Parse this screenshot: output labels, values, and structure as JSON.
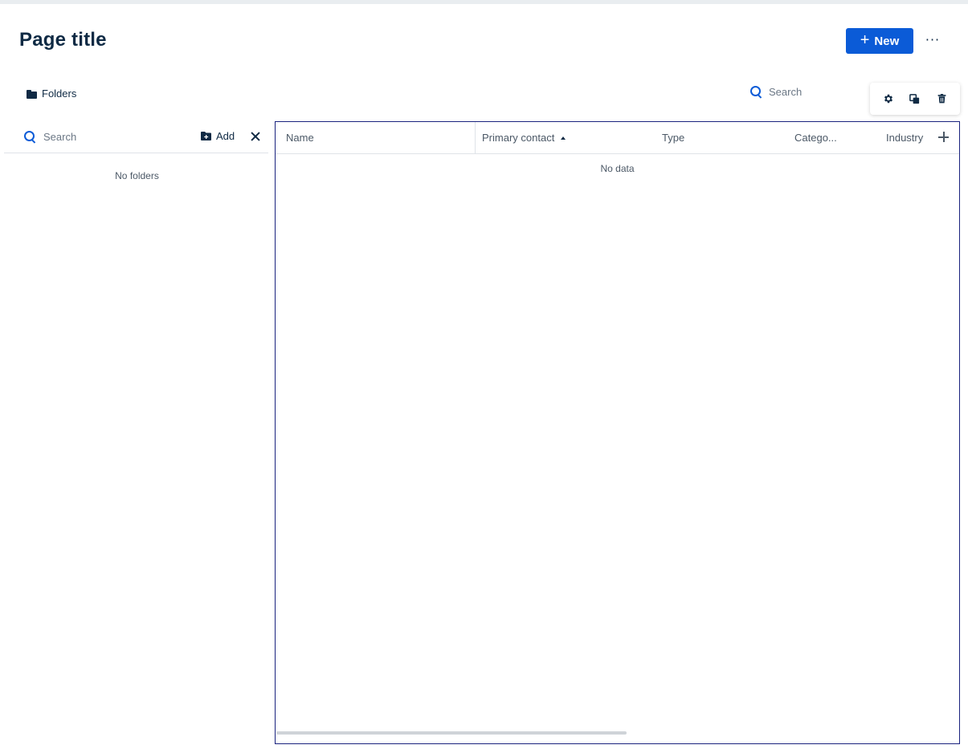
{
  "header": {
    "title": "Page title",
    "new_label": "New",
    "more_label": "···"
  },
  "folders": {
    "label": "Folders",
    "search_placeholder": "Search",
    "add_label": "Add",
    "empty_text": "No folders"
  },
  "main": {
    "search_placeholder": "Search",
    "columns": [
      "Name",
      "Primary contact",
      "Type",
      "Catego...",
      "Industry"
    ],
    "sorted_column": "Primary contact",
    "sort_direction": "ascending",
    "empty_text": "No data"
  },
  "toolbar": {
    "icons": [
      "gear-icon",
      "copy-icon",
      "trash-icon"
    ]
  },
  "colors": {
    "accent": "#0b5bd7",
    "text": "#0f2a44",
    "grid_border": "#1a237e"
  }
}
